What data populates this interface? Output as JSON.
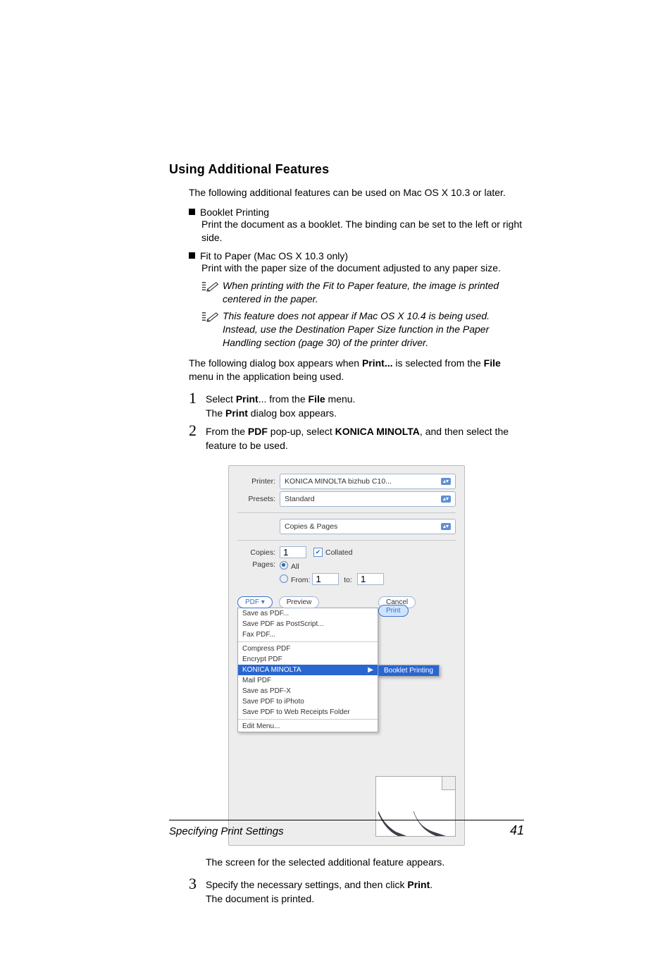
{
  "heading": "Using Additional Features",
  "intro": "The following additional features can be used on Mac OS X 10.3 or later.",
  "bullets": [
    {
      "title": "Booklet Printing",
      "desc": "Print the document as a booklet. The binding can be set to the left or right side."
    },
    {
      "title": "Fit to Paper (Mac OS X 10.3 only)",
      "desc": "Print with the paper size of the document adjusted to any paper size."
    }
  ],
  "notes": [
    "When printing with the Fit to Paper feature, the image is printed centered in the paper.",
    "This feature does not appear if Mac OS X 10.4 is being used. Instead, use the Destination Paper Size function in the Paper Handling section (page 30) of the printer driver."
  ],
  "para_before_steps": {
    "pre": "The following dialog box appears when ",
    "bold1": "Print...",
    "mid": " is selected from the ",
    "bold2": "File",
    "post": " menu in the application being used."
  },
  "steps": {
    "s1": {
      "pre": "Select ",
      "b1": "Print",
      "mid1": "... from the ",
      "b2": "File",
      "post1": " menu.",
      "line2_pre": "The ",
      "line2_b": "Print",
      "line2_post": " dialog box appears."
    },
    "s2": {
      "pre": "From the ",
      "b1": "PDF",
      "mid1": " pop-up, select ",
      "b2": "KONICA MINOLTA",
      "post1": ", and then select the feature to be used."
    },
    "intermission": "The screen for the selected additional feature appears.",
    "s3": {
      "pre": "Specify the necessary settings, and then click ",
      "b1": "Print",
      "post1": ".",
      "line2": "The document is printed."
    }
  },
  "dialog": {
    "labels": {
      "printer": "Printer:",
      "presets": "Presets:",
      "section": "Copies & Pages",
      "copies": "Copies:",
      "pages": "Pages:",
      "from": "From:",
      "to": "to:"
    },
    "values": {
      "printer": "KONICA MINOLTA bizhub C10...",
      "presets": "Standard",
      "copies": "1",
      "collated": "Collated",
      "all": "All",
      "from": "1",
      "to": "1"
    },
    "buttons": {
      "pdf": "PDF ▾",
      "preview": "Preview",
      "cancel": "Cancel",
      "print": "Print"
    },
    "menu": {
      "group1": [
        "Save as PDF...",
        "Save PDF as PostScript...",
        "Fax PDF..."
      ],
      "group2": [
        "Compress PDF",
        "Encrypt PDF"
      ],
      "highlight": "KONICA MINOLTA",
      "submenu": "Booklet Printing",
      "group3": [
        "Mail PDF",
        "Save as PDF-X",
        "Save PDF to iPhoto",
        "Save PDF to Web Receipts Folder"
      ],
      "group4": [
        "Edit Menu..."
      ]
    }
  },
  "footer": {
    "left": "Specifying Print Settings",
    "right": "41"
  }
}
